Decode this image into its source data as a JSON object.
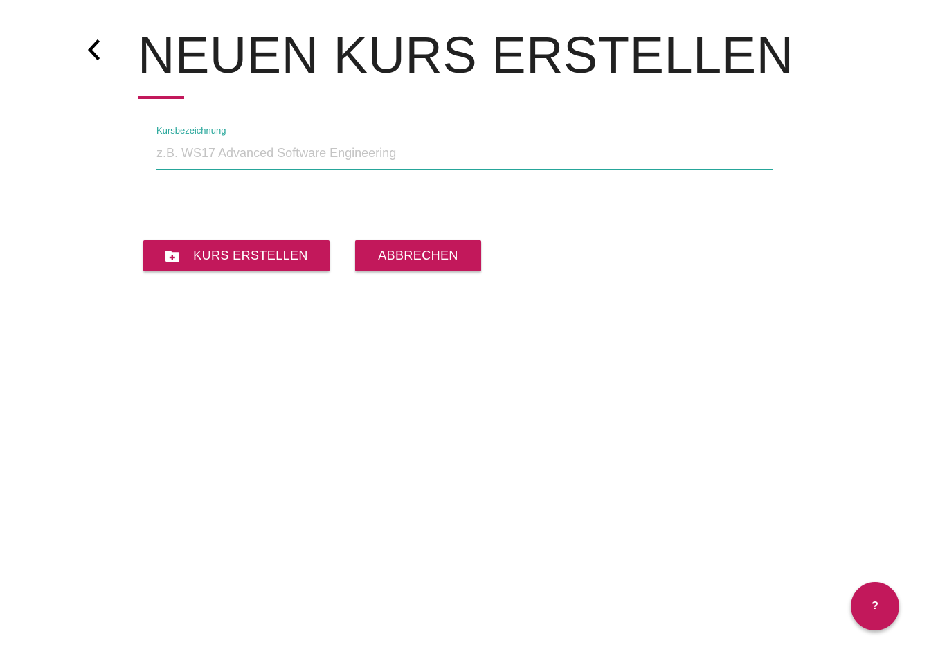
{
  "header": {
    "back_icon": "chevron-left-icon",
    "title": "NEUEN KURS ERSTELLEN"
  },
  "form": {
    "course_name": {
      "label": "Kursbezeichnung",
      "value": "",
      "placeholder": "z.B. WS17 Advanced Software Engineering"
    }
  },
  "actions": {
    "create_label": "KURS ERSTELLEN",
    "create_icon": "folder-add-icon",
    "cancel_label": "ABBRECHEN"
  },
  "help": {
    "label": "?"
  },
  "colors": {
    "accent": "#c2185b",
    "input_focus": "#26a69a",
    "title_text": "#212121",
    "placeholder": "#c4c4c4"
  }
}
